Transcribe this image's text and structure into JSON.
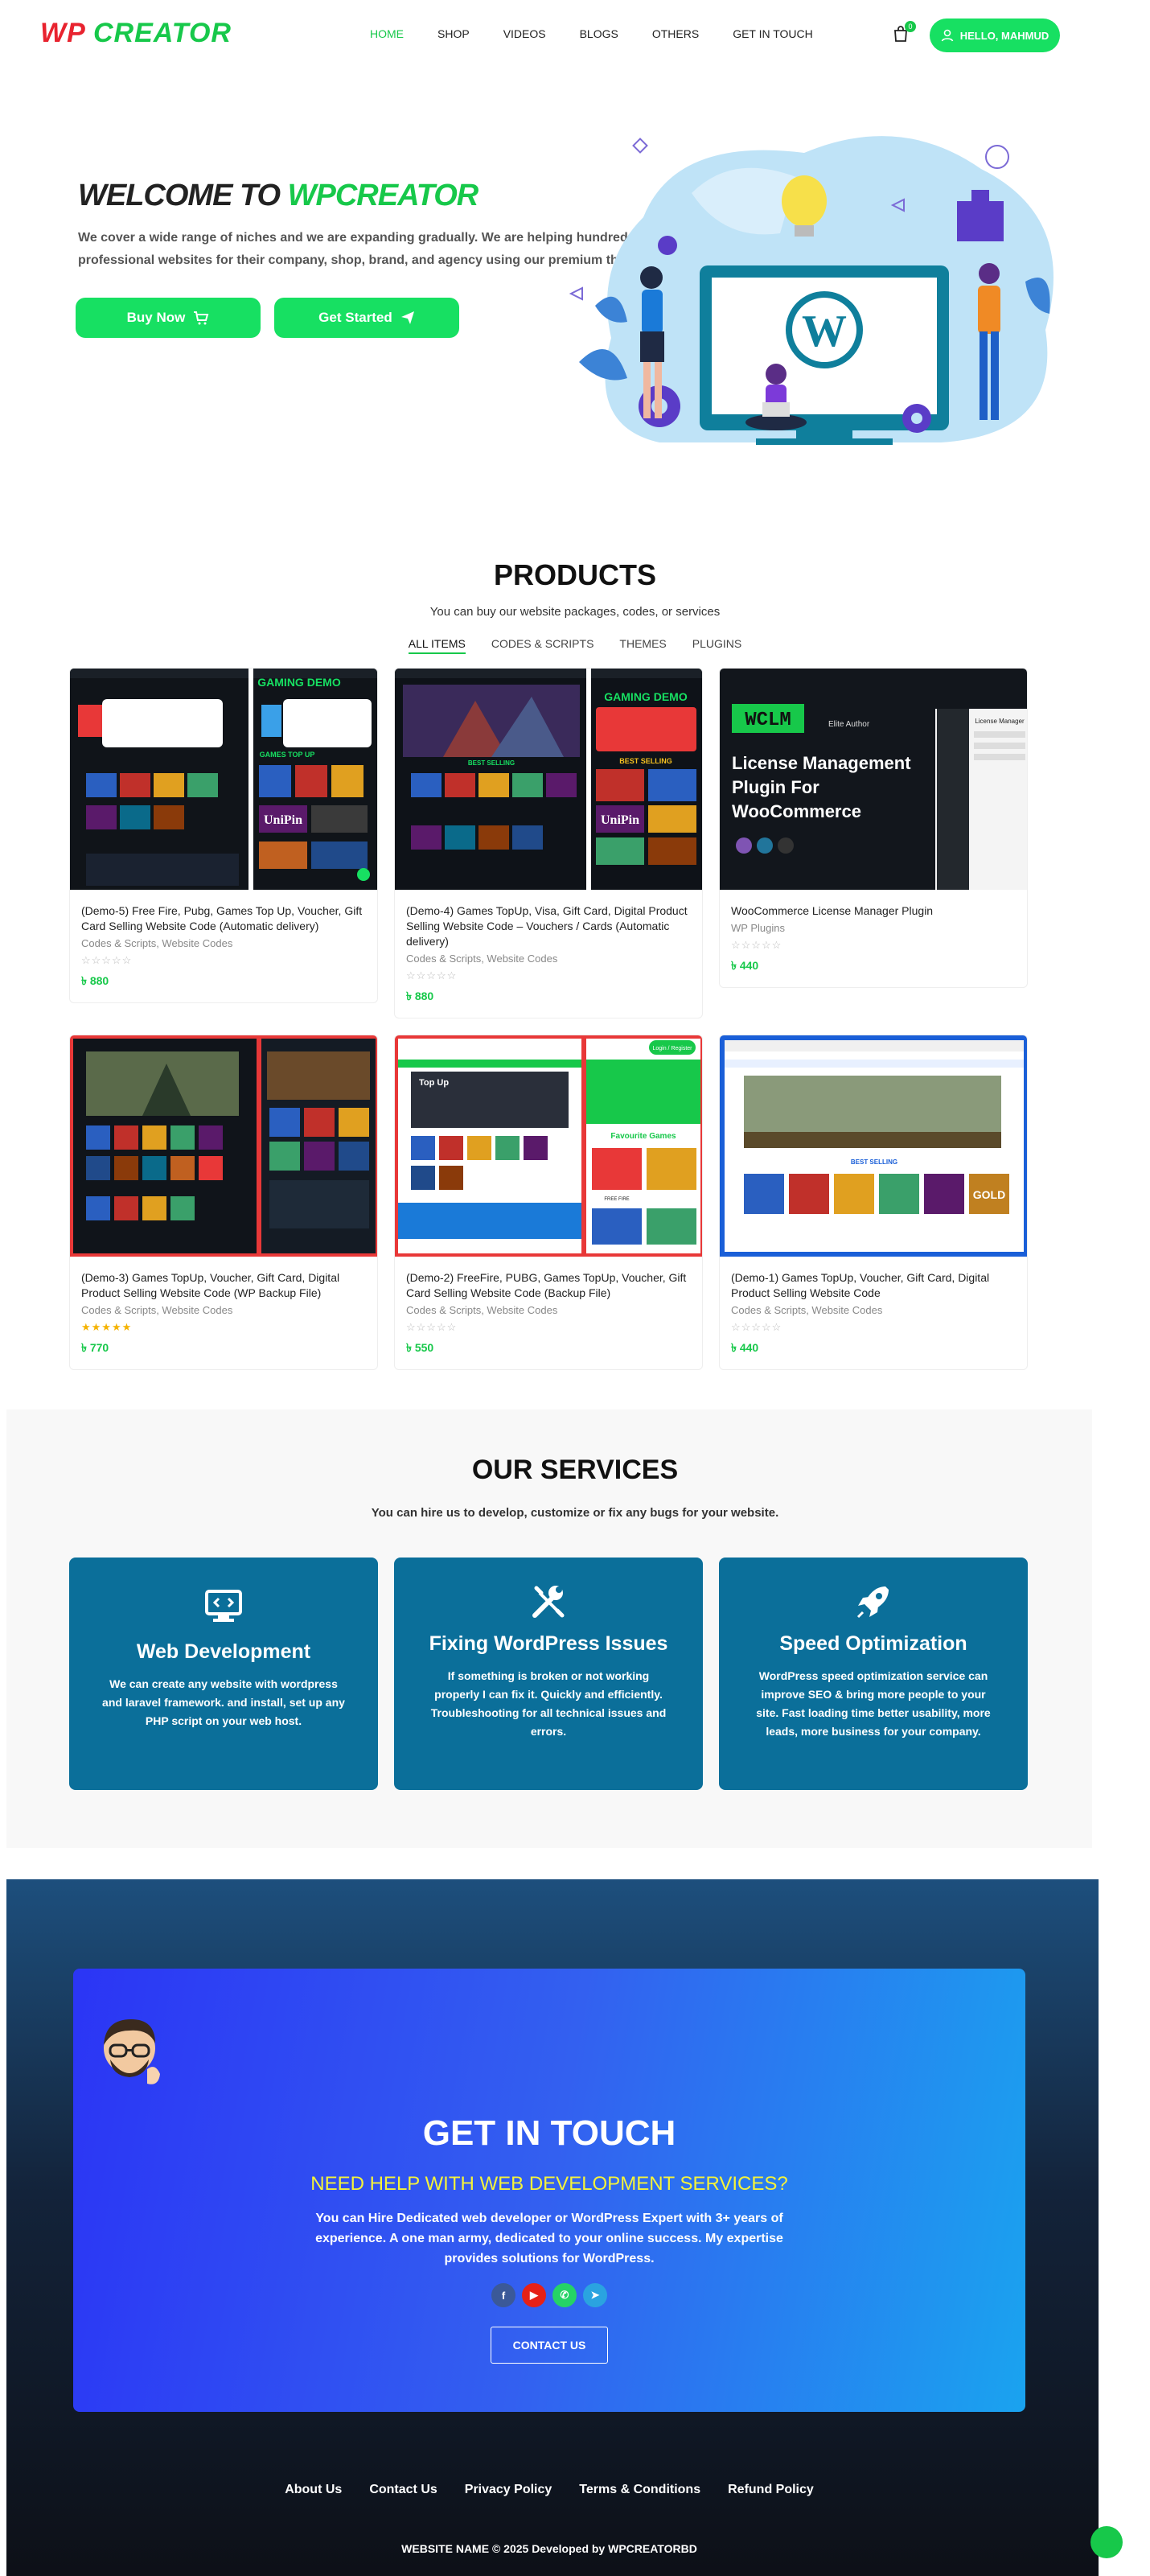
{
  "header": {
    "logo_part1": "WP",
    "logo_part2": "CREATOR",
    "nav": [
      "HOME",
      "SHOP",
      "VIDEOS",
      "BLOGS",
      "OTHERS",
      "GET IN TOUCH"
    ],
    "cart_count": "0",
    "hello_label": "HELLO, MAHMUD"
  },
  "hero": {
    "title_prefix": "WELCOME TO ",
    "title_accent": "WPCREATOR",
    "text": "We cover a wide range of niches and we are expanding gradually. We are helping hundreds of companies, startups and individuals to build professional websites for their company, shop, brand, and agency using our premium themes, codes, and services.",
    "buy_label": "Buy Now",
    "start_label": "Get Started"
  },
  "products": {
    "title": "PRODUCTS",
    "subtitle": "You can buy our website packages, codes, or services",
    "tabs": [
      "ALL ITEMS",
      "CODES & SCRIPTS",
      "THEMES",
      "PLUGINS"
    ],
    "items": [
      {
        "title": "(Demo-5) Free Fire, Pubg, Games Top Up, Voucher, Gift Card Selling Website Code (Automatic delivery)",
        "category": "Codes & Scripts, Website Codes",
        "stars": "☆☆☆☆☆",
        "price": "৳ 880"
      },
      {
        "title": "(Demo-4) Games TopUp, Visa, Gift Card, Digital Product Selling Website Code – Vouchers / Cards (Automatic delivery)",
        "category": "Codes & Scripts, Website Codes",
        "stars": "☆☆☆☆☆",
        "price": "৳ 880"
      },
      {
        "title": "WooCommerce License Manager Plugin",
        "category": "WP Plugins",
        "stars": "☆☆☆☆☆",
        "price": "৳ 440"
      },
      {
        "title": "(Demo-3) Games TopUp, Voucher, Gift Card, Digital Product Selling Website Code (WP Backup File)",
        "category": "Codes & Scripts, Website Codes",
        "stars": "★★★★★",
        "price": "৳ 770"
      },
      {
        "title": "(Demo-2) FreeFire, PUBG, Games TopUp, Voucher, Gift Card Selling Website Code (Backup File)",
        "category": "Codes & Scripts, Website Codes",
        "stars": "☆☆☆☆☆",
        "price": "৳ 550"
      },
      {
        "title": "(Demo-1) Games TopUp, Voucher, Gift Card, Digital Product Selling Website Code",
        "category": "Codes & Scripts, Website Codes",
        "stars": "☆☆☆☆☆",
        "price": "৳ 440"
      }
    ],
    "thumb_texts": {
      "gaming_demo": "GAMING DEMO",
      "games_top_up": "GAMES TOP UP",
      "best_selling": "BEST SELLING",
      "unipin": "UniPin",
      "wclm": "WCLM",
      "elite_author": "Elite Author",
      "wclm_heading": "License Management Plugin For WooCommerce",
      "license_manager": "License Manager",
      "top_up": "Top Up",
      "favourite_games": "Favourite Games",
      "login_register": "Login / Register",
      "free_fire": "FREE FIRE",
      "gold": "GOLD"
    }
  },
  "services": {
    "title": "OUR SERVICES",
    "subtitle": "You can hire us to develop, customize or fix any bugs for your website.",
    "items": [
      {
        "icon": "monitor-code-icon",
        "title": "Web Development",
        "text": "We can create any website with wordpress and laravel framework. and install, set up any PHP script on your web host."
      },
      {
        "icon": "tools-icon",
        "title": "Fixing WordPress Issues",
        "text": "If something is broken or not working properly I can fix it. Quickly and efficiently. Troubleshooting for all technical issues and errors."
      },
      {
        "icon": "rocket-icon",
        "title": "Speed Optimization",
        "text": "WordPress speed optimization service can improve SEO & bring more people to your site. Fast loading time better usability, more leads, more business for your company."
      }
    ]
  },
  "touch": {
    "title": "GET IN TOUCH",
    "subtitle": "NEED HELP WITH WEB DEVELOPMENT SERVICES?",
    "text": "You can Hire Dedicated web developer or WordPress Expert with 3+ years of experience. A one man army, dedicated to your online success. My expertise provides solutions for WordPress.",
    "socials": [
      {
        "icon": "facebook-icon",
        "glyph": "f",
        "color": "#3b5998"
      },
      {
        "icon": "youtube-icon",
        "glyph": "▶",
        "color": "#e62117"
      },
      {
        "icon": "whatsapp-icon",
        "glyph": "✆",
        "color": "#25d366"
      },
      {
        "icon": "telegram-icon",
        "glyph": "➤",
        "color": "#2aa3e0"
      }
    ],
    "button": "CONTACT US"
  },
  "footer": {
    "links": [
      "About Us",
      "Contact Us",
      "Privacy Policy",
      "Terms & Conditions",
      "Refund Policy"
    ],
    "copyright": "WEBSITE NAME © 2025 Developed by WPCREATORBD"
  }
}
